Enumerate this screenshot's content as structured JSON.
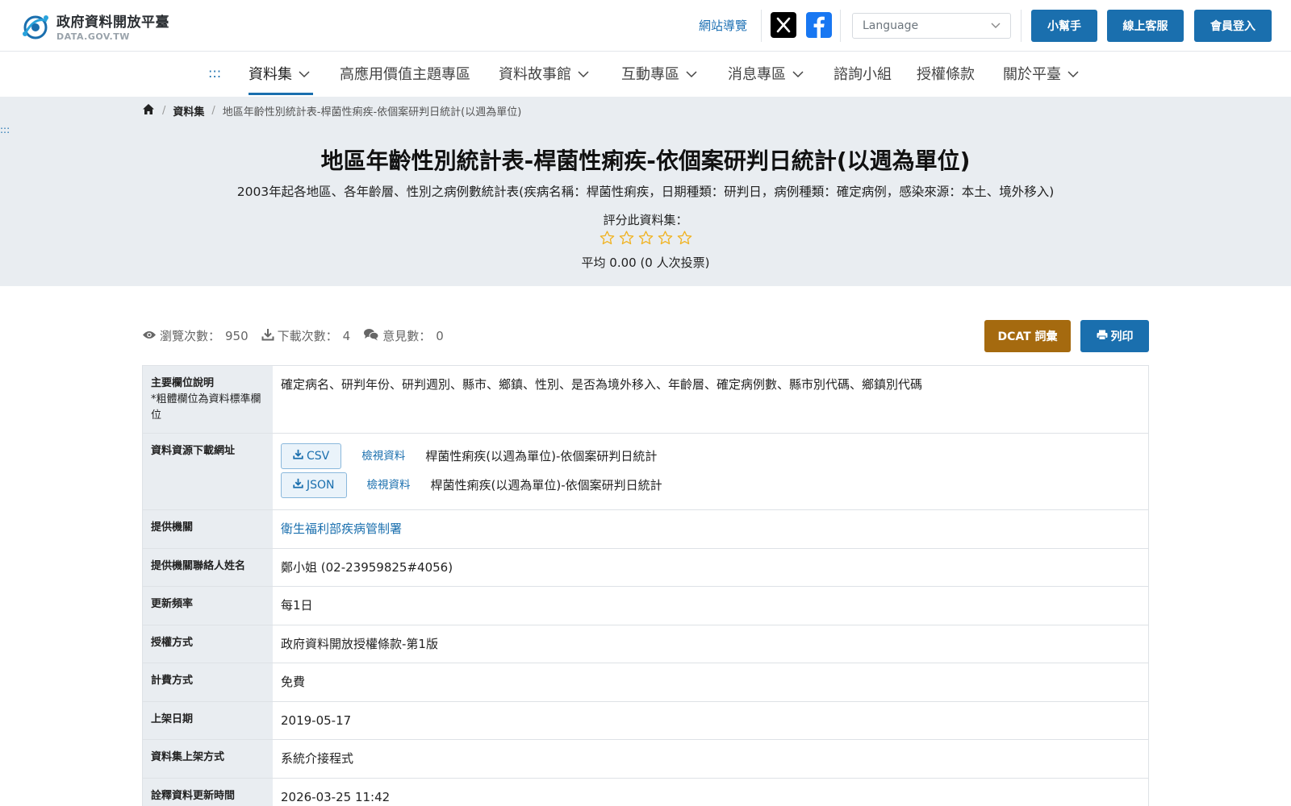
{
  "header": {
    "logo_title": "政府資料開放平臺",
    "logo_sub": "DATA.GOV.TW",
    "site_guide": "網站導覽",
    "language_placeholder": "Language",
    "helper_btn": "小幫手",
    "service_btn": "線上客服",
    "login_btn": "會員登入",
    "icons": [
      "x-icon",
      "facebook-icon",
      "chevron-down-icon"
    ]
  },
  "nav": {
    "dots": ":::",
    "items": [
      {
        "label": "資料集",
        "dropdown": true,
        "active": true
      },
      {
        "label": "高應用價值主題專區",
        "dropdown": false
      },
      {
        "label": "資料故事館",
        "dropdown": true
      },
      {
        "label": "互動專區",
        "dropdown": true
      },
      {
        "label": "消息專區",
        "dropdown": true
      },
      {
        "label": "諮詢小組",
        "dropdown": false
      },
      {
        "label": "授權條款",
        "dropdown": false
      },
      {
        "label": "關於平臺",
        "dropdown": true
      }
    ]
  },
  "breadcrumb": {
    "home_icon": "home-icon",
    "section": "資料集",
    "current": "地區年齡性別統計表-桿菌性痢疾-依個案研判日統計(以週為單位)"
  },
  "side_dots": ":::",
  "dataset": {
    "title": "地區年齡性別統計表-桿菌性痢疾-依個案研判日統計(以週為單位)",
    "description": "2003年起各地區、各年齡層、性別之病例數統計表(疾病名稱：桿菌性痢疾，日期種類：研判日，病例種類：確定病例，感染來源：本土、境外移入)",
    "rating_label": "評分此資料集：",
    "rating_value": 0,
    "rating_max": 5,
    "average_text": "平均 0.00 (0 人次投票)"
  },
  "stats": {
    "views_label": "瀏覽次數：",
    "views": "950",
    "downloads_label": "下載次數：",
    "downloads": "4",
    "comments_label": "意見數：",
    "comments": "0",
    "dcat_btn": "DCAT 詞彙",
    "print_btn": "列印"
  },
  "details": {
    "fields_label": "主要欄位說明",
    "fields_note": "*粗體欄位為資料標準欄位",
    "fields_value": "確定病名、研判年份、研判週別、縣市、鄉鎮、性別、是否為境外移入、年齡層、確定病例數、縣市別代碼、鄉鎮別代碼",
    "resources_label": "資料資源下載網址",
    "resources": [
      {
        "format": "CSV",
        "view": "檢視資料",
        "name": "桿菌性痢疾(以週為單位)-依個案研判日統計"
      },
      {
        "format": "JSON",
        "view": "檢視資料",
        "name": "桿菌性痢疾(以週為單位)-依個案研判日統計"
      }
    ],
    "rows": [
      {
        "label": "提供機關",
        "value": "衛生福利部疾病管制署",
        "link": true
      },
      {
        "label": "提供機關聯絡人姓名",
        "value": "鄭小姐 (02-23959825#4056)",
        "link": false
      },
      {
        "label": "更新頻率",
        "value": "每1日",
        "link": false
      },
      {
        "label": "授權方式",
        "value": "政府資料開放授權條款-第1版",
        "link": false
      },
      {
        "label": "計費方式",
        "value": "免費",
        "link": false
      },
      {
        "label": "上架日期",
        "value": "2019-05-17",
        "link": false
      },
      {
        "label": "資料集上架方式",
        "value": "系統介接程式",
        "link": false
      },
      {
        "label": "詮釋資料更新時間",
        "value": "2026-03-25 11:42",
        "link": false
      }
    ]
  },
  "colors": {
    "primary": "#1a6fae",
    "dcat": "#a56a0f",
    "hero_bg": "#e9edf1",
    "star": "#f0b323"
  }
}
